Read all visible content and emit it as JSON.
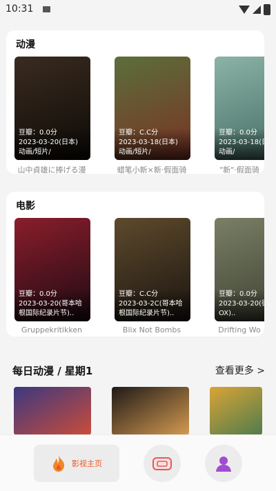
{
  "status_bar": {
    "time": "10:31"
  },
  "anime": {
    "title": "动漫",
    "items": [
      {
        "score": "豆瓣：0.0分",
        "date": "2023-03-20(日本)",
        "genre": "动画/短片/",
        "title": "山中貞雄に捧げる漫",
        "color1": "#3a2b20",
        "color2": "#0d0a06"
      },
      {
        "score": "豆瓣：C.C分",
        "date": "2023-03-18(日本)",
        "genre": "动画/短片/",
        "title": "蜡笔小新×新·假面骑",
        "color1": "#5b6e3b",
        "color2": "#7a3324"
      },
      {
        "score": "豆瓣：0.0分",
        "date": "2023-03-18(日",
        "genre": "动画/",
        "title": "\"新\"·假面骑",
        "color1": "#8bb3a7",
        "color2": "#436b62"
      }
    ]
  },
  "movie": {
    "title": "电影",
    "items": [
      {
        "score": "豆瓣：0.0分",
        "date": "2023-03-20(哥本哈",
        "genre": "根国际纪录片节)..",
        "title": "Gruppekritikken",
        "color1": "#8a1e2c",
        "color2": "#1d0a12"
      },
      {
        "score": "豆瓣：C.C分",
        "date": "2023-03-2C(哥本哈",
        "genre": "根国际纪录片节)..",
        "title": "Blix Not Bombs",
        "color1": "#5e4a2c",
        "color2": "#1a1410"
      },
      {
        "score": "豆瓣：0.0分",
        "date": "2023-03-20(德",
        "genre": "OX)..",
        "title": "Drifting Wo",
        "color1": "#7a7f66",
        "color2": "#3c4030"
      }
    ]
  },
  "daily": {
    "title": "每日动漫 / 星期1",
    "more": "查看更多 >",
    "posters": [
      {
        "color1": "#3c3880",
        "color2": "#c94c3a"
      },
      {
        "color1": "#1f1a18",
        "color2": "#d49a50"
      },
      {
        "color1": "#d9a437",
        "color2": "#4f7c4c"
      }
    ]
  },
  "nav": {
    "home_label": "影视主页",
    "accent": "#e85a2b",
    "icons": [
      "flame-icon",
      "tv-icon",
      "user-icon"
    ]
  }
}
